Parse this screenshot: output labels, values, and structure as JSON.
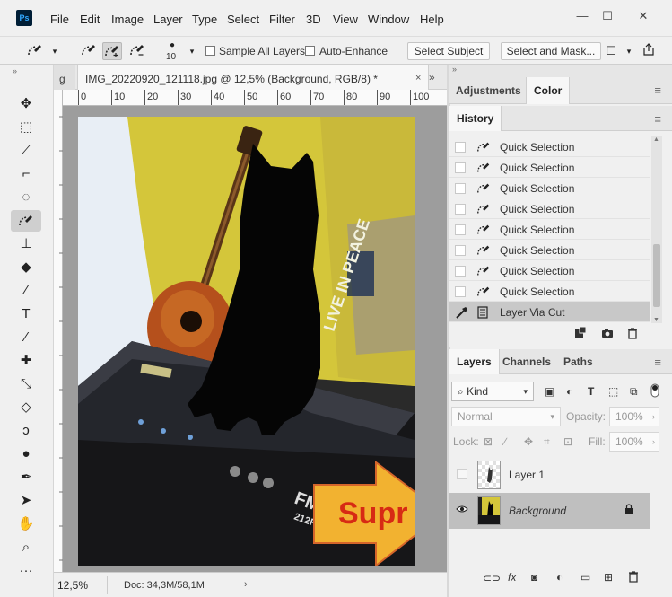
{
  "app": {
    "logo": "Ps"
  },
  "menu": [
    "File",
    "Edit",
    "Image",
    "Layer",
    "Type",
    "Select",
    "Filter",
    "3D",
    "View",
    "Window",
    "Help"
  ],
  "window_controls": {
    "minimize": "—",
    "maximize": "☐",
    "close": "✕"
  },
  "options": {
    "brush_size": "10",
    "sample_all_layers": "Sample All Layers",
    "auto_enhance": "Auto-Enhance",
    "select_subject": "Select Subject",
    "select_and_mask": "Select and Mask..."
  },
  "toolbar_header": "»",
  "tabs": {
    "prev_fragment": "g",
    "close_glyph": "×",
    "active_title": "IMG_20220920_121118.jpg @ 12,5% (Background, RGB/8) *",
    "overflow": "»"
  },
  "ruler": {
    "ticks": [
      "0",
      "10",
      "20",
      "30",
      "40",
      "50",
      "60",
      "70",
      "80",
      "90",
      "100"
    ]
  },
  "canvas": {
    "overlay_text": "Supr",
    "wall_text": "LIVE IN PEACE",
    "amp_brand": "FM",
    "amp_model": "212R",
    "colors": {
      "wall": "#d4c63a",
      "overlay_text": "#d72a14",
      "arrow": "#f2b230",
      "cat": "#050505"
    }
  },
  "status": {
    "zoom": "12,5%",
    "doc": "Doc: 34,3M/58,1M",
    "arrow": "›"
  },
  "panels": {
    "top_tabs": [
      "Adjustments",
      "Color"
    ],
    "history_tab": "History",
    "history": [
      {
        "label": "Quick Selection"
      },
      {
        "label": "Quick Selection"
      },
      {
        "label": "Quick Selection"
      },
      {
        "label": "Quick Selection"
      },
      {
        "label": "Quick Selection"
      },
      {
        "label": "Quick Selection"
      },
      {
        "label": "Quick Selection"
      },
      {
        "label": "Quick Selection"
      },
      {
        "label": "Layer Via Cut",
        "selected": true
      }
    ],
    "layers_tabs": [
      "Layers",
      "Channels",
      "Paths"
    ],
    "filter_kind": "Kind",
    "blend_mode": "Normal",
    "opacity_label": "Opacity:",
    "opacity_value": "100%",
    "lock_label": "Lock:",
    "fill_label": "Fill:",
    "fill_value": "100%",
    "layers": [
      {
        "name": "Layer 1",
        "visible": false
      },
      {
        "name": "Background",
        "visible": true,
        "selected": true,
        "locked": true
      }
    ]
  }
}
